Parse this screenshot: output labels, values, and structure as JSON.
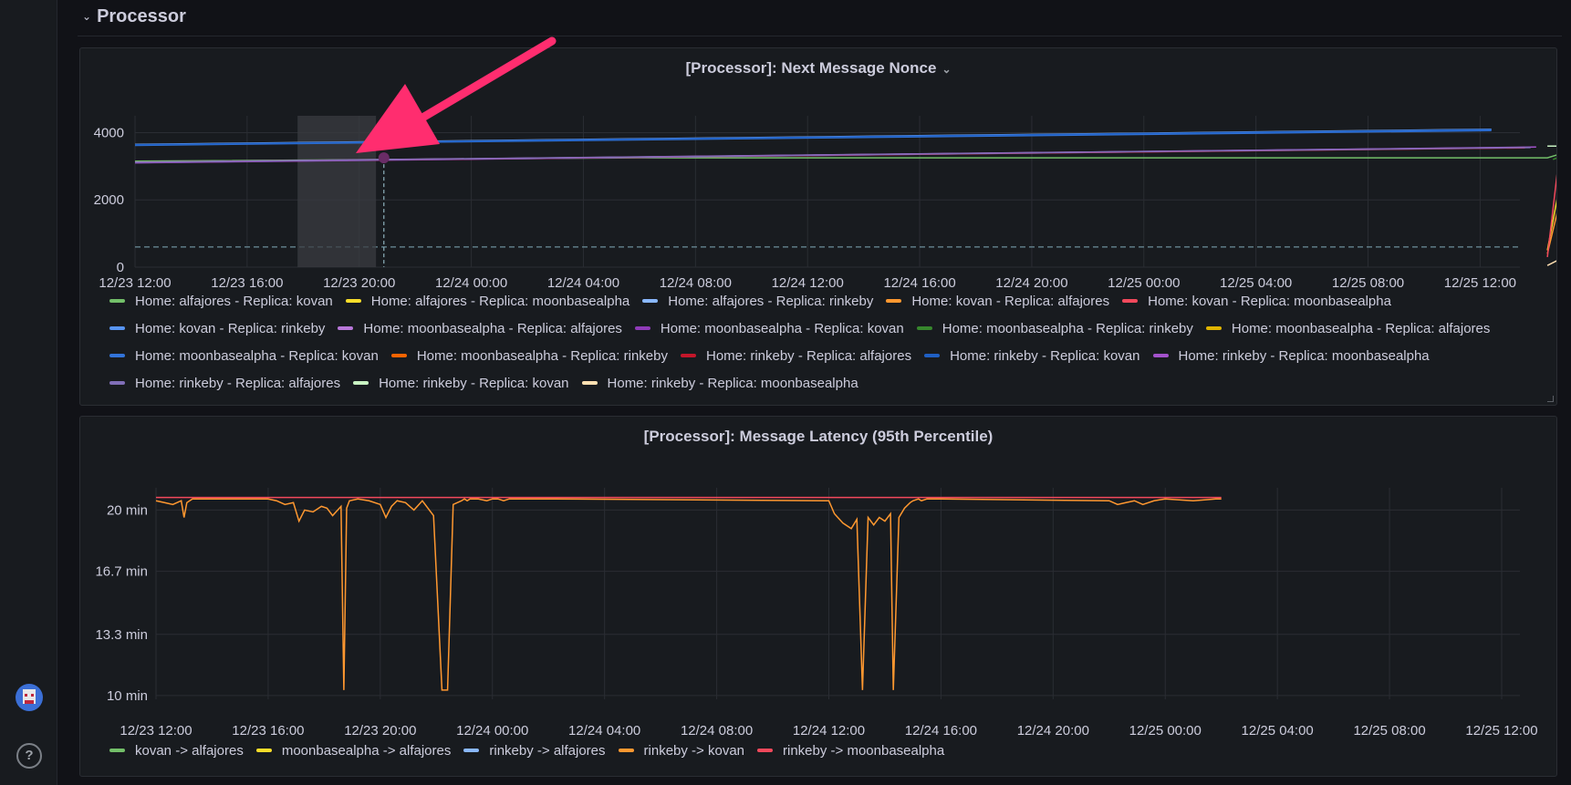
{
  "row": {
    "title": "Processor"
  },
  "panels": [
    {
      "title": "[Processor]: Next Message Nonce",
      "chart_data": {
        "type": "line",
        "title": "[Processor]: Next Message Nonce",
        "x_ticks": [
          "12/23 12:00",
          "12/23 16:00",
          "12/23 20:00",
          "12/24 00:00",
          "12/24 04:00",
          "12/24 08:00",
          "12/24 12:00",
          "12/24 16:00",
          "12/24 20:00",
          "12/25 00:00",
          "12/25 04:00",
          "12/25 08:00",
          "12/25 12:00"
        ],
        "y_ticks": [
          "0",
          "2000",
          "4000"
        ],
        "ylim": [
          0,
          4500
        ],
        "threshold": 600,
        "series": [
          {
            "name": "Home: alfajores - Replica: kovan",
            "color": "#73bf69",
            "x": [
              0,
              4.5,
              4.51,
              12.6,
              12.7,
              12.8,
              19.7
            ],
            "y": [
              3150,
              3250,
              3250,
              3250,
              3350,
              3580,
              3600
            ]
          },
          {
            "name": "Home: alfajores - Replica: moonbasealpha",
            "color": "#fade2a",
            "x": [
              12.6,
              12.75,
              12.9,
              13.1,
              19.7
            ],
            "y": [
              500,
              3150,
              3300,
              3560,
              3580
            ]
          },
          {
            "name": "Home: alfajores - Replica: rinkeby",
            "color": "#8ab8ff",
            "x": [
              0,
              12.1
            ],
            "y": [
              3650,
              4100
            ]
          },
          {
            "name": "Home: kovan - Replica: alfajores",
            "color": "#ff9830",
            "x": [
              12.6,
              12.8,
              12.95,
              13.1,
              19.7
            ],
            "y": [
              400,
              3200,
              3400,
              3600,
              3620
            ]
          },
          {
            "name": "Home: kovan - Replica: moonbasealpha",
            "color": "#f2495c",
            "x": [
              12.6,
              12.7,
              12.85,
              13.0,
              19.7
            ],
            "y": [
              300,
              3150,
              3450,
              3600,
              3600
            ]
          },
          {
            "name": "Home: kovan - Replica: rinkeby",
            "color": "#5794f2",
            "x": [
              0,
              12.1
            ],
            "y": [
              3630,
              4080
            ]
          },
          {
            "name": "Home: moonbasealpha - Replica: alfajores",
            "color": "#b877d9",
            "x": [
              0,
              12.4
            ],
            "y": [
              3120,
              3560
            ]
          },
          {
            "name": "Home: moonbasealpha - Replica: kovan",
            "color": "#8f3bb8",
            "x": [
              0,
              12.4
            ],
            "y": [
              3100,
              3550
            ]
          },
          {
            "name": "Home: moonbasealpha - Replica: rinkeby",
            "color": "#37872d",
            "x": [
              12.65,
              12.8,
              13.0,
              19.7
            ],
            "y": [
              3200,
              3400,
              3580,
              3600
            ]
          },
          {
            "name": "Home: moonbasealpha - Replica: alfajores",
            "color": "#e0b400",
            "x": [
              12.7,
              12.9,
              13.2,
              19.7
            ],
            "y": [
              3100,
              3350,
              3560,
              3580
            ]
          },
          {
            "name": "Home: moonbasealpha - Replica: kovan",
            "color": "#3274d9",
            "x": [
              0,
              12.1
            ],
            "y": [
              3620,
              4060
            ]
          },
          {
            "name": "Home: moonbasealpha - Replica: rinkeby",
            "color": "#fa6400",
            "x": [
              12.9,
              13.1,
              19.7
            ],
            "y": [
              3450,
              3620,
              3620
            ]
          },
          {
            "name": "Home: rinkeby - Replica: alfajores",
            "color": "#c4162a",
            "x": [
              0,
              12.4
            ],
            "y": [
              3110,
              3545
            ]
          },
          {
            "name": "Home: rinkeby - Replica: kovan",
            "color": "#1f60c4",
            "x": [
              0,
              12.1
            ],
            "y": [
              3640,
              4090
            ]
          },
          {
            "name": "Home: rinkeby - Replica: moonbasealpha",
            "color": "#a352cc",
            "x": [
              0,
              12.5
            ],
            "y": [
              3105,
              3570
            ]
          },
          {
            "name": "Home: rinkeby - Replica: alfajores",
            "color": "#806eb7",
            "x": [
              0,
              12.45
            ],
            "y": [
              3115,
              3555
            ]
          },
          {
            "name": "Home: rinkeby - Replica: kovan",
            "color": "#c8f2c2",
            "x": [
              12.6,
              12.7,
              19.7
            ],
            "y": [
              3600,
              3600,
              3610
            ]
          },
          {
            "name": "Home: rinkeby - Replica: moonbasealpha",
            "color": "#ffe0b2",
            "x": [
              12.6,
              12.75,
              13.05,
              13.35,
              13.6,
              19.7
            ],
            "y": [
              50,
              300,
              1800,
              3300,
              3620,
              3640
            ]
          }
        ]
      }
    },
    {
      "title": "[Processor]: Message Latency (95th Percentile)",
      "chart_data": {
        "type": "line",
        "title": "[Processor]: Message Latency (95th Percentile)",
        "x_ticks": [
          "12/23 12:00",
          "12/23 16:00",
          "12/23 20:00",
          "12/24 00:00",
          "12/24 04:00",
          "12/24 08:00",
          "12/24 12:00",
          "12/24 16:00",
          "12/24 20:00",
          "12/25 00:00",
          "12/25 04:00",
          "12/25 08:00",
          "12/25 12:00"
        ],
        "y_ticks": [
          "10 min",
          "13.3 min",
          "16.7 min",
          "20 min"
        ],
        "ylim": [
          9.8,
          21.2
        ],
        "series": [
          {
            "name": "kovan -> alfajores",
            "color": "#73bf69",
            "x": [],
            "y": []
          },
          {
            "name": "moonbasealpha -> alfajores",
            "color": "#fade2a",
            "x": [],
            "y": []
          },
          {
            "name": "rinkeby -> alfajores",
            "color": "#8ab8ff",
            "x": [],
            "y": []
          },
          {
            "name": "rinkeby -> kovan",
            "color": "#ff9830",
            "x": [
              0,
              0.3,
              0.6,
              0.9,
              1.0,
              1.1,
              1.3,
              1.5,
              4.0,
              4.3,
              4.6,
              4.9,
              5.1,
              5.3,
              5.6,
              5.9,
              6.1,
              6.3,
              6.6,
              6.7,
              6.8,
              6.9,
              7.2,
              7.6,
              8.0,
              8.2,
              8.4,
              8.6,
              8.9,
              9.2,
              9.5,
              9.9,
              10.2,
              10.4,
              10.6,
              10.9,
              11.0,
              11.1,
              11.2,
              11.5,
              11.8,
              12.0,
              12.2,
              12.4,
              12.6,
              13.0,
              14.2,
              24.0,
              24.2,
              24.5,
              24.8,
              25.0,
              25.2,
              25.4,
              25.6,
              25.8,
              26.0,
              26.2,
              26.3,
              26.5,
              26.7,
              26.9,
              27.0,
              27.2,
              27.3,
              27.5,
              27.7,
              28.0,
              34.0,
              34.3,
              34.6,
              34.9,
              35.2,
              35.6,
              36.0,
              37.0,
              37.8,
              38.0
            ],
            "y": [
              20.5,
              20.4,
              20.3,
              20.5,
              19.6,
              20.4,
              20.6,
              20.6,
              20.6,
              20.5,
              20.3,
              20.4,
              19.4,
              20.0,
              19.9,
              20.2,
              20.1,
              19.7,
              20.2,
              10.3,
              20.1,
              20.5,
              20.6,
              20.5,
              20.3,
              19.6,
              20.2,
              20.5,
              20.4,
              20.0,
              20.5,
              19.7,
              10.3,
              10.3,
              20.3,
              20.5,
              20.6,
              20.5,
              20.6,
              20.6,
              20.5,
              20.6,
              20.6,
              20.5,
              20.6,
              20.6,
              20.6,
              20.5,
              19.8,
              19.3,
              19.0,
              19.5,
              10.3,
              19.6,
              19.2,
              19.6,
              19.4,
              19.8,
              10.3,
              19.6,
              20.1,
              20.4,
              20.5,
              20.6,
              20.5,
              20.6,
              20.6,
              20.6,
              20.5,
              20.3,
              20.4,
              20.5,
              20.3,
              20.5,
              20.6,
              20.5,
              20.6,
              20.6
            ]
          },
          {
            "name": "rinkeby -> moonbasealpha",
            "color": "#f2495c",
            "x": [
              0,
              38.0
            ],
            "y": [
              20.68,
              20.68
            ]
          }
        ]
      }
    }
  ]
}
